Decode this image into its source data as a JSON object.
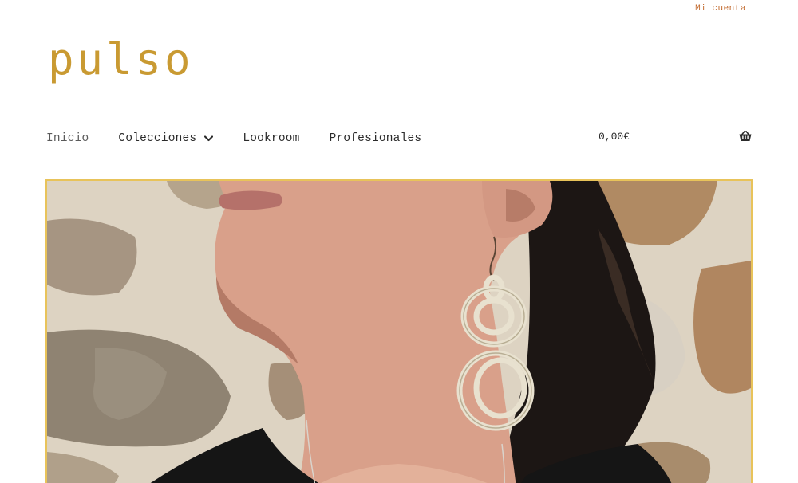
{
  "header": {
    "account_link": "Mi cuenta",
    "logo_text": "pulso"
  },
  "nav": {
    "items": [
      {
        "label": "Inicio",
        "current": true
      },
      {
        "label": "Colecciones",
        "has_dropdown": true
      },
      {
        "label": "Lookroom"
      },
      {
        "label": "Profesionales"
      }
    ]
  },
  "cart": {
    "total": "0,00€",
    "icon": "basket-icon"
  },
  "hero": {
    "icon": "hero-photo-woman-earring"
  },
  "colors": {
    "logo": "#c99a32",
    "account_link": "#c26a2e",
    "hero_border": "#e8c35a"
  }
}
